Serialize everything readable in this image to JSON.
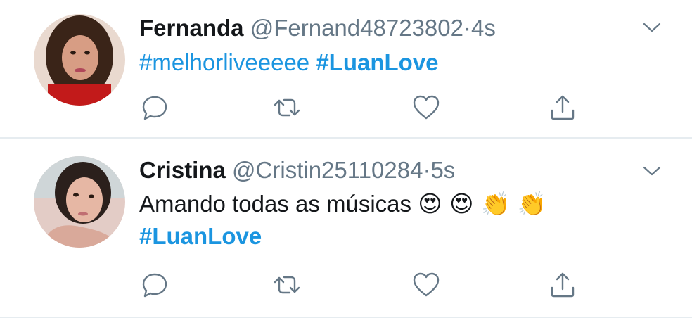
{
  "tweets": [
    {
      "name": "Fernanda",
      "handle": "@Fernand48723802",
      "separator": "·",
      "time": "4s",
      "hashtag_1": "#melhorliveeeee",
      "hashtag_2": "#LuanLove"
    },
    {
      "name": "Cristina",
      "handle": "@Cristin25110284",
      "separator": "·",
      "time": "5s",
      "text": "Amando todas as músicas",
      "emojis": "😍 😍 👏 👏",
      "hashtag": "#LuanLove"
    }
  ],
  "colors": {
    "hashtag": "#1b95e0",
    "meta": "#657786",
    "icon": "#657786",
    "divider": "#e6ecf0"
  },
  "icons": [
    "chevron-down-icon",
    "reply-icon",
    "retweet-icon",
    "like-icon",
    "share-icon"
  ]
}
